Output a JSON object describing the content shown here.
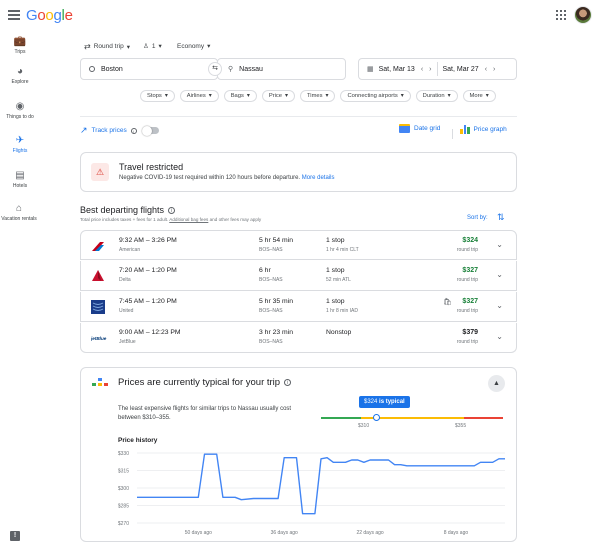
{
  "header": {
    "logo": "Google"
  },
  "sidebar": {
    "items": [
      {
        "label": "Trips",
        "icon": "suitcase-icon"
      },
      {
        "label": "Explore",
        "icon": "globe-icon"
      },
      {
        "label": "Things to do",
        "icon": "camera-icon"
      },
      {
        "label": "Flights",
        "icon": "airplane-icon"
      },
      {
        "label": "Hotels",
        "icon": "bed-icon"
      },
      {
        "label": "Vacation rentals",
        "icon": "house-icon"
      }
    ]
  },
  "search": {
    "trip_type": "Round trip",
    "passengers": "1",
    "cabin": "Economy",
    "origin": "Boston",
    "destination": "Nassau",
    "depart_date": "Sat, Mar 13",
    "return_date": "Sat, Mar 27"
  },
  "filters": [
    "Stops",
    "Airlines",
    "Bags",
    "Price",
    "Times",
    "Connecting airports",
    "Duration",
    "More"
  ],
  "toolbar": {
    "track_prices": "Track prices",
    "date_grid": "Date grid",
    "price_graph": "Price graph"
  },
  "restriction": {
    "title": "Travel restricted",
    "body": "Negative COVID-19 test required within 120 hours before departure.",
    "link": "More details"
  },
  "results": {
    "title": "Best departing flights",
    "note_pre": "Total price includes taxes + fees for 1 adult.",
    "note_link": "Additional bag fees",
    "note_post": "and other fees may apply",
    "sort_label": "Sort by:",
    "flights": [
      {
        "times": "9:32 AM – 3:26 PM",
        "airline": "American",
        "duration": "5 hr 54 min",
        "route": "BOS–NAS",
        "stops": "1 stop",
        "layover": "1 hr 4 min CLT",
        "price": "$324",
        "price_note": "round trip",
        "price_color": "#188038",
        "logo": "american-airlines-logo"
      },
      {
        "times": "7:20 AM – 1:20 PM",
        "airline": "Delta",
        "duration": "6 hr",
        "route": "BOS–NAS",
        "stops": "1 stop",
        "layover": "52 min ATL",
        "price": "$327",
        "price_note": "round trip",
        "price_color": "#188038",
        "logo": "delta-logo"
      },
      {
        "times": "7:45 AM – 1:20 PM",
        "airline": "United",
        "duration": "5 hr 35 min",
        "route": "BOS–NAS",
        "stops": "1 stop",
        "layover": "1 hr 8 min IAD",
        "price": "$327",
        "price_note": "round trip",
        "price_color": "#188038",
        "logo": "united-logo"
      },
      {
        "times": "9:00 AM – 12:23 PM",
        "airline": "JetBlue",
        "duration": "3 hr 23 min",
        "route": "BOS–NAS",
        "stops": "Nonstop",
        "layover": "",
        "price": "$379",
        "price_note": "round trip",
        "price_color": "#202124",
        "logo": "jetblue-logo"
      }
    ]
  },
  "insight": {
    "title": "Prices are currently typical for your trip",
    "body": "The least expensive flights for similar trips to Nassau usually cost between $310–355.",
    "badge_price": "$324",
    "badge_text": "is typical",
    "range_low": "$310",
    "range_high": "$355",
    "history_label": "Price history"
  },
  "chart_data": {
    "type": "line",
    "title": "Price history",
    "y_ticks": [
      "$330",
      "$315",
      "$300",
      "$285",
      "$270"
    ],
    "x_ticks": [
      "50 days ago",
      "36 days ago",
      "22 days ago",
      "8 days ago"
    ],
    "ylim": [
      270,
      330
    ],
    "xlim": [
      60,
      0
    ],
    "series": [
      {
        "color": "#4285f4",
        "x": [
          60,
          50,
          49,
          47,
          46,
          44,
          43,
          41,
          40,
          37,
          36,
          34,
          33,
          31,
          30,
          29,
          28,
          26,
          25,
          24,
          23,
          22,
          19,
          18,
          17,
          16,
          14,
          13,
          11,
          10,
          5,
          4,
          2,
          1,
          0
        ],
        "y": [
          292,
          292,
          329,
          329,
          292,
          292,
          290,
          291,
          291,
          291,
          326,
          326,
          278,
          278,
          325,
          326,
          322,
          322,
          324,
          324,
          322,
          324,
          324,
          320,
          320,
          319,
          319,
          319,
          319,
          319,
          319,
          322,
          322,
          325,
          325
        ]
      }
    ]
  }
}
